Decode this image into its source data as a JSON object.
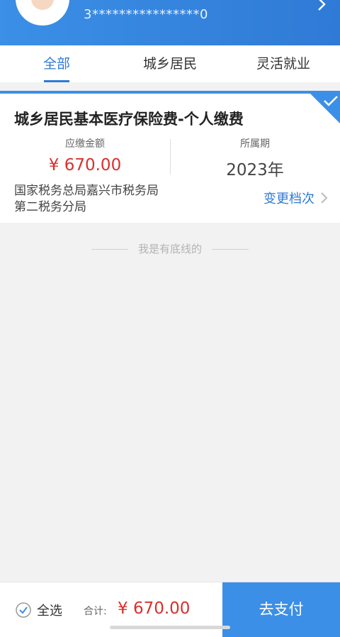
{
  "header": {
    "id_number": "3****************0"
  },
  "tabs": [
    {
      "label": "全部",
      "active": true
    },
    {
      "label": "城乡居民",
      "active": false
    },
    {
      "label": "灵活就业",
      "active": false
    }
  ],
  "card": {
    "title": "城乡居民基本医疗保险费-个人缴费",
    "amount_label": "应缴金额",
    "amount": "¥ 670.00",
    "period_label": "所属期",
    "period": "2023年",
    "office": "国家税务总局嘉兴市税务局第二税务分局",
    "change_level": "变更档次",
    "selected": true
  },
  "bottom_note": "我是有底线的",
  "footer": {
    "select_all": "全选",
    "total_label": "合计:",
    "total_amount": "¥ 670.00",
    "pay_button": "去支付"
  },
  "colors": {
    "primary": "#3b8fe6",
    "accent_red": "#d9302b"
  }
}
